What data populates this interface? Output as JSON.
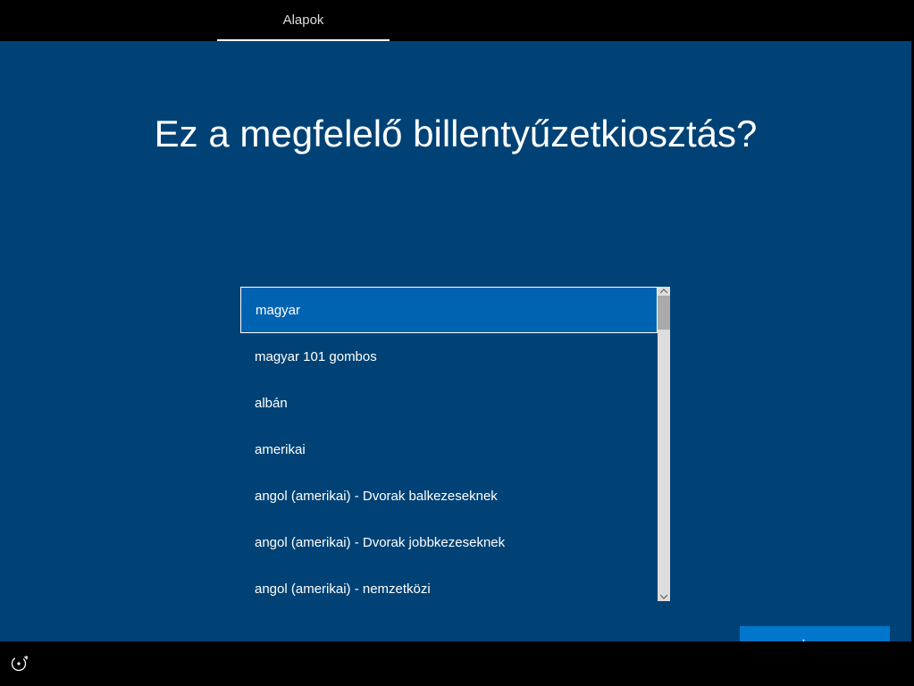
{
  "topTab": {
    "label": "Alapok"
  },
  "heading": "Ez a megfelelő billentyűzetkiosztás?",
  "keyboardList": {
    "selectedIndex": 0,
    "items": [
      "magyar",
      "magyar 101 gombos",
      "albán",
      "amerikai",
      "angol (amerikai) - Dvorak balkezeseknek",
      "angol (amerikai) - Dvorak jobbkezeseknek",
      "angol (amerikai) - nemzetközi"
    ]
  },
  "buttons": {
    "yes": "Igen"
  }
}
